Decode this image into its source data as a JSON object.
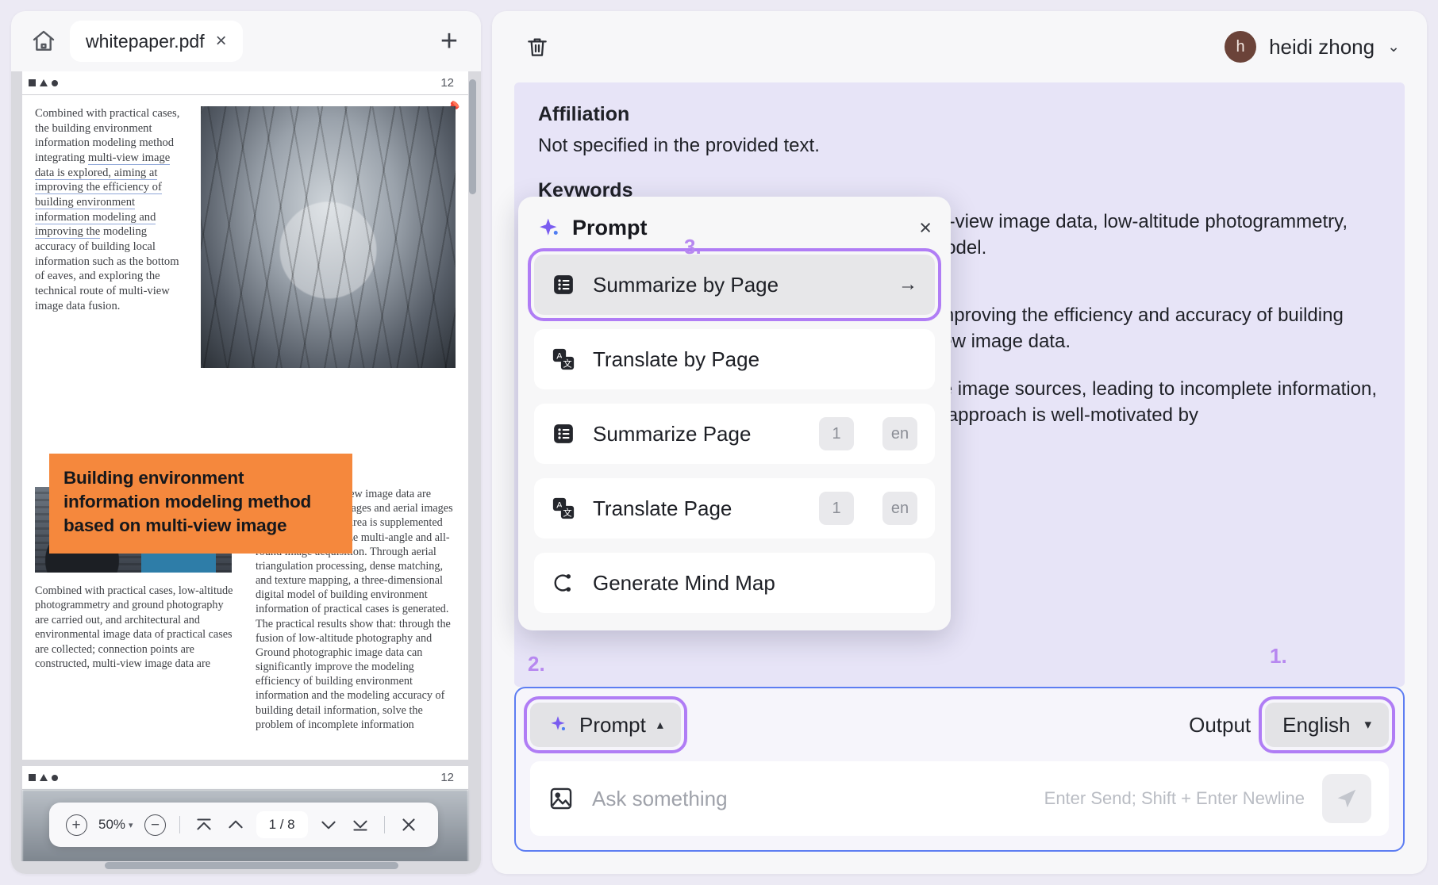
{
  "pdf_panel": {
    "home_icon": "home-icon",
    "tab": {
      "label": "whitepaper.pdf",
      "close": "×"
    },
    "new_tab": "+",
    "page_indicator_top": "12",
    "page_indicator_bottom": "12",
    "document": {
      "left_column_paragraph": "Combined with practical cases, the building environment information modeling method integrating ",
      "left_column_underlined": "multi-view image data is explored, aiming at improving the efficiency of building environment information modeling and improving the",
      "left_column_tail": " modeling accuracy of building local information such as the bottom of eaves, and exploring the technical route of multi-view image data fusion.",
      "cover_title": "Building environment information modeling method based on multi-view image",
      "paragraph_left_lower": "Combined with practical cases, low-altitude photogrammetry and ground photography are carried out, and architectural and environmental image data of practical cases are collected; connection points are constructed, multi-view image data are",
      "paragraph_right": "constructed, multi-view image data are fused, and ground images and aerial images are fused. The blind area is supplemented by the image to realize multi-angle and all-round image acquisition. Through aerial triangulation processing, dense matching, and texture mapping, a three-dimensional digital model of building environment information of practical cases is generated. The practical results show that: through the fusion of low-altitude photography and Ground photographic image data can significantly improve the modeling efficiency of building environment information and the modeling accuracy of building detail information, solve the problem of incomplete information"
    },
    "toolbar": {
      "zoom_in": "+",
      "zoom_level": "50%",
      "zoom_caret": "▾",
      "zoom_out": "−",
      "first_page_icon": "jump-to-first-page-icon",
      "prev_page_icon": "previous-page-icon",
      "page_counter": "1 / 8",
      "next_page_icon": "next-page-icon",
      "last_page_icon": "jump-to-last-page-icon",
      "close": "×"
    }
  },
  "chat_panel": {
    "trash_icon": "trash-icon",
    "user": {
      "initial": "h",
      "name": "heidi zhong",
      "caret": "⌄"
    },
    "message": {
      "affiliation_heading": "Affiliation",
      "affiliation_body": "Not specified in the provided text.",
      "keywords_heading": "Keywords",
      "keywords_body_line1": "Building environment information modeling, multi-view image data, low-altitude photogrammetry, ground photography, three-dimensional digital model.",
      "comment_line1": "The research question is clear and focused on improving the efficiency and accuracy of building environment information modeling using multi-view image data.",
      "comment_line2": "Traditional modeling methods often rely on single image sources, leading to incomplete information, especially for complex structures. The proposed approach is well-motivated by"
    }
  },
  "prompt_popover": {
    "sparkle_icon": "sparkle-icon",
    "title": "Prompt",
    "close": "×",
    "items": [
      {
        "icon": "list-summary-icon",
        "label": "Summarize by Page",
        "arrow": "→",
        "badges": [],
        "selected": true
      },
      {
        "icon": "translate-icon",
        "label": "Translate by Page",
        "arrow": "",
        "badges": [],
        "selected": false
      },
      {
        "icon": "list-summary-icon",
        "label": "Summarize Page",
        "arrow": "",
        "badges": [
          "1",
          "en"
        ],
        "selected": false
      },
      {
        "icon": "translate-icon",
        "label": "Translate Page",
        "arrow": "",
        "badges": [
          "1",
          "en"
        ],
        "selected": false
      },
      {
        "icon": "mind-map-icon",
        "label": "Generate Mind Map",
        "arrow": "",
        "badges": [],
        "selected": false
      }
    ]
  },
  "steps": {
    "one": "1.",
    "two": "2.",
    "three": "3."
  },
  "composer": {
    "prompt_button": {
      "label": "Prompt",
      "caret": "▴",
      "icon": "sparkle-icon"
    },
    "output_label": "Output",
    "language": {
      "value": "English",
      "caret": "▾"
    },
    "image_icon": "image-attachment-icon",
    "input_placeholder": "Ask something",
    "send_hint": "Enter Send; Shift + Enter Newline",
    "send_icon": "send-icon"
  },
  "colors": {
    "accent_purple": "#b07df5",
    "focus_blue": "#5d7df2",
    "message_bg": "#e7e4f7",
    "avatar_bg": "#6b4339",
    "cover_orange": "#f5883d"
  }
}
